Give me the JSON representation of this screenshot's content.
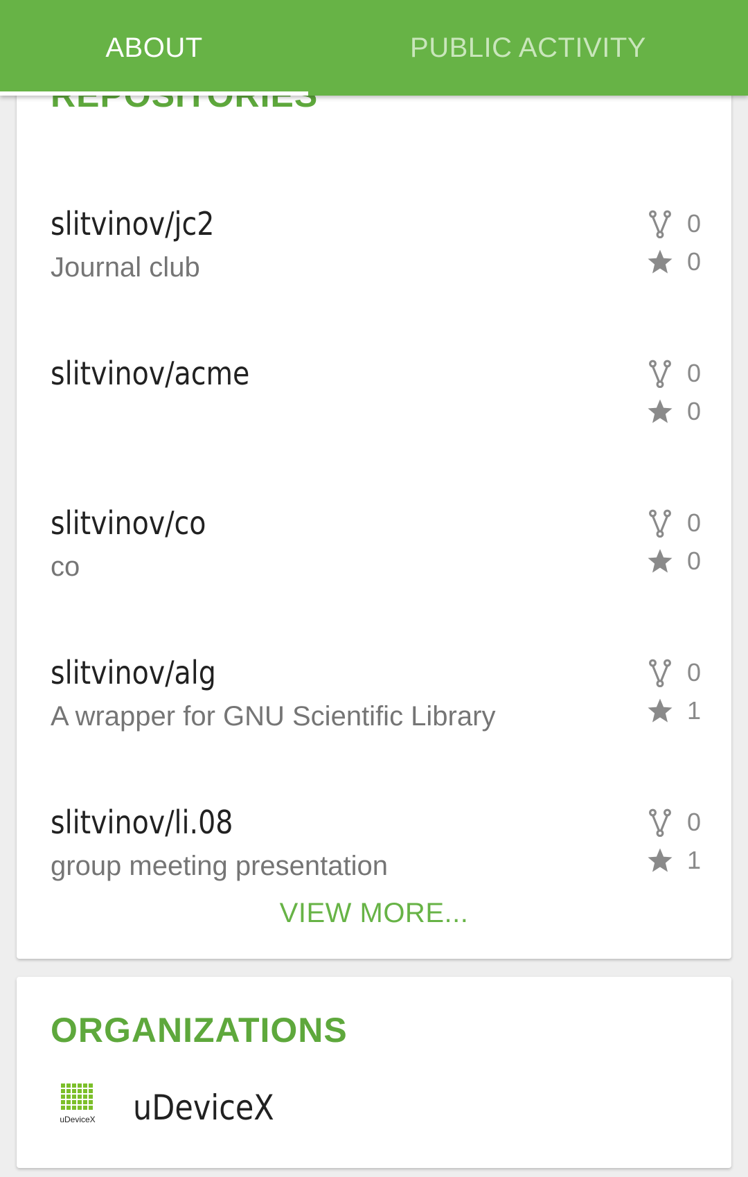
{
  "tabs": {
    "about": "ABOUT",
    "public_activity": "PUBLIC ACTIVITY"
  },
  "repositories": {
    "title": "REPOSITORIES",
    "items": [
      {
        "name": "slitvinov/jc2",
        "description": "Journal club",
        "forks": "0",
        "stars": "0"
      },
      {
        "name": "slitvinov/acme",
        "description": "",
        "forks": "0",
        "stars": "0"
      },
      {
        "name": "slitvinov/co",
        "description": "co",
        "forks": "0",
        "stars": "0"
      },
      {
        "name": "slitvinov/alg",
        "description": "A wrapper for GNU Scientific Library",
        "forks": "0",
        "stars": "1"
      },
      {
        "name": "slitvinov/li.08",
        "description": "group meeting presentation",
        "forks": "0",
        "stars": "1"
      }
    ],
    "view_more": "VIEW MORE..."
  },
  "organizations": {
    "title": "ORGANIZATIONS",
    "items": [
      {
        "name": "uDeviceX",
        "logo_text": "uDeviceX",
        "icon": "udevicex-logo"
      }
    ]
  },
  "icons": {
    "fork": "fork-icon",
    "star": "star-icon"
  },
  "colors": {
    "primary": "#67b346",
    "accent_text": "#5ea83c",
    "inactive_tab": "#c9e6bb",
    "icon_gray": "#8a8a8a"
  }
}
